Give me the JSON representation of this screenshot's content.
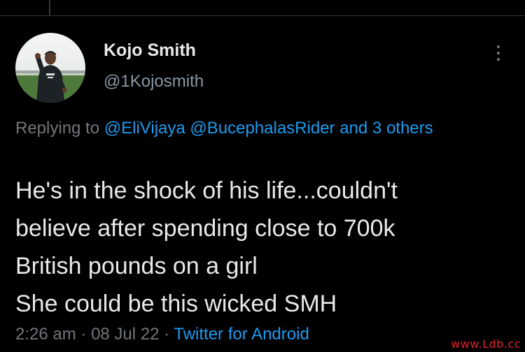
{
  "tweet": {
    "author": {
      "display_name": "Kojo Smith",
      "handle": "@1Kojosmith",
      "avatar_icon": "profile-photo"
    },
    "more_icon": "vertical-ellipsis-icon",
    "replying": {
      "prefix": "Replying to",
      "mentions": [
        "@EliVijaya",
        "@BucephalasRider"
      ],
      "and": "and",
      "others_link": "3 others"
    },
    "text_lines": [
      "He's in the shock of his life...couldn't",
      "believe after spending close to 700k",
      "British pounds on a girl",
      "She could be this wicked SMH"
    ],
    "meta": {
      "time": "2:26 am",
      "sep": "·",
      "date": "08 Jul 22",
      "source": "Twitter for Android"
    }
  },
  "watermark": "www.Ldb.cc",
  "colors": {
    "background": "#000000",
    "text": "#e7e9ea",
    "secondary": "#71767b",
    "link": "#1d9bf0",
    "watermark": "#e0202a"
  }
}
